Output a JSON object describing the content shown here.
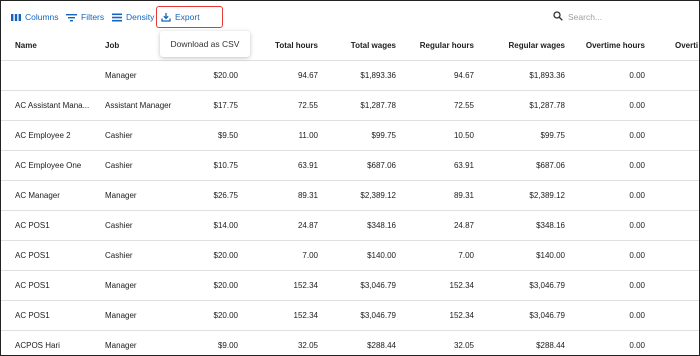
{
  "toolbar": {
    "columns_label": "Columns",
    "filters_label": "Filters",
    "density_label": "Density",
    "export_label": "Export"
  },
  "export_menu": {
    "download_csv_label": "Download as CSV"
  },
  "search": {
    "placeholder": "Search...",
    "value": ""
  },
  "colors": {
    "accent": "#1565c0",
    "highlight_border": "#e53935"
  },
  "table": {
    "headers": [
      "Name",
      "Job",
      "",
      "Total hours",
      "Total wages",
      "Regular hours",
      "Regular wages",
      "Overtime hours",
      "Overti"
    ],
    "rows": [
      [
        "",
        "Manager",
        "$20.00",
        "94.67",
        "$1,893.36",
        "94.67",
        "$1,893.36",
        "0.00",
        ""
      ],
      [
        "AC Assistant Mana...",
        "Assistant Manager",
        "$17.75",
        "72.55",
        "$1,287.78",
        "72.55",
        "$1,287.78",
        "0.00",
        ""
      ],
      [
        "AC Employee 2",
        "Cashier",
        "$9.50",
        "11.00",
        "$99.75",
        "10.50",
        "$99.75",
        "0.00",
        ""
      ],
      [
        "AC Employee One",
        "Cashier",
        "$10.75",
        "63.91",
        "$687.06",
        "63.91",
        "$687.06",
        "0.00",
        ""
      ],
      [
        "AC Manager",
        "Manager",
        "$26.75",
        "89.31",
        "$2,389.12",
        "89.31",
        "$2,389.12",
        "0.00",
        ""
      ],
      [
        "AC POS1",
        "Cashier",
        "$14.00",
        "24.87",
        "$348.16",
        "24.87",
        "$348.16",
        "0.00",
        ""
      ],
      [
        "AC POS1",
        "Cashier",
        "$20.00",
        "7.00",
        "$140.00",
        "7.00",
        "$140.00",
        "0.00",
        ""
      ],
      [
        "AC POS1",
        "Manager",
        "$20.00",
        "152.34",
        "$3,046.79",
        "152.34",
        "$3,046.79",
        "0.00",
        ""
      ],
      [
        "AC POS1",
        "Manager",
        "$20.00",
        "152.34",
        "$3,046.79",
        "152.34",
        "$3,046.79",
        "0.00",
        ""
      ],
      [
        "ACPOS Hari",
        "Manager",
        "$9.00",
        "32.05",
        "$288.44",
        "32.05",
        "$288.44",
        "0.00",
        ""
      ]
    ]
  }
}
